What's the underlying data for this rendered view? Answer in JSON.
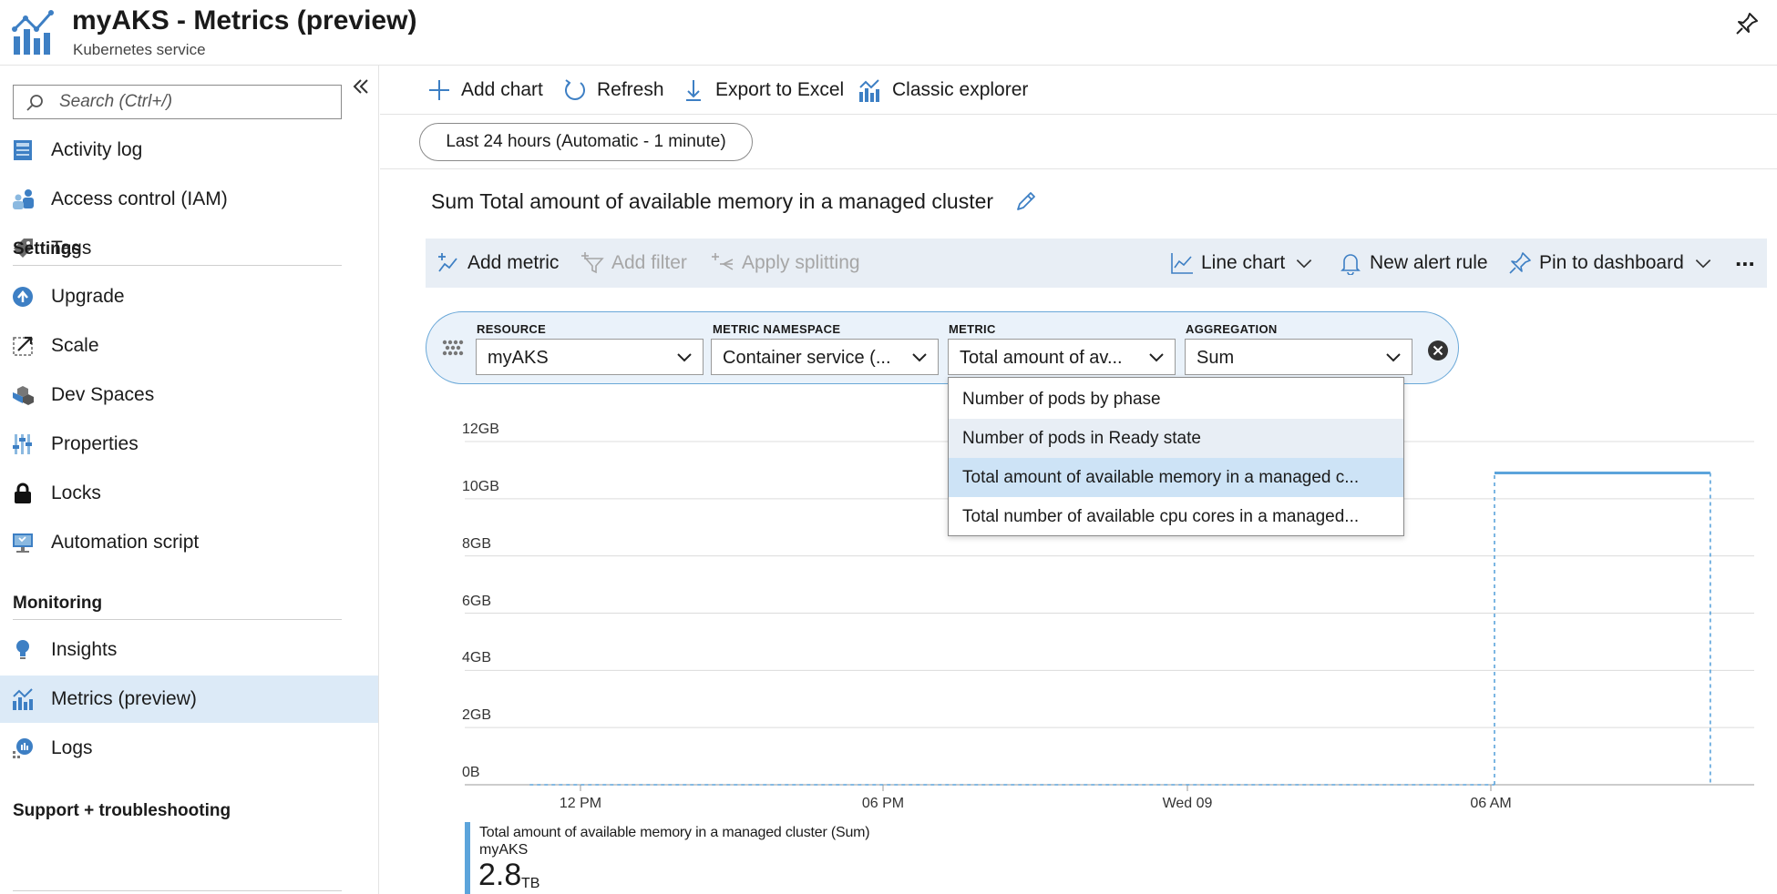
{
  "header": {
    "title": "myAKS - Metrics (preview)",
    "subtitle": "Kubernetes service"
  },
  "sidebar": {
    "search_placeholder": "Search (Ctrl+/)",
    "items_top": [
      {
        "label": "Activity log",
        "icon": "activity-log-icon"
      },
      {
        "label": "Access control (IAM)",
        "icon": "iam-people-icon"
      },
      {
        "label": "Tags",
        "icon": "tag-icon"
      }
    ],
    "settings_heading": "Settings",
    "settings_items": [
      {
        "label": "Upgrade",
        "icon": "upgrade-arrow-icon"
      },
      {
        "label": "Scale",
        "icon": "scale-icon"
      },
      {
        "label": "Dev Spaces",
        "icon": "dev-spaces-icon"
      },
      {
        "label": "Properties",
        "icon": "properties-sliders-icon"
      },
      {
        "label": "Locks",
        "icon": "lock-icon"
      },
      {
        "label": "Automation script",
        "icon": "automation-monitor-icon"
      }
    ],
    "monitoring_heading": "Monitoring",
    "monitoring_items": [
      {
        "label": "Insights",
        "icon": "lightbulb-icon"
      },
      {
        "label": "Metrics (preview)",
        "icon": "metrics-chart-icon",
        "active": true
      },
      {
        "label": "Logs",
        "icon": "logs-icon"
      }
    ],
    "support_heading": "Support + troubleshooting"
  },
  "toolbar": {
    "add_chart": "Add chart",
    "refresh": "Refresh",
    "export": "Export to Excel",
    "classic": "Classic explorer"
  },
  "time_range": "Last 24 hours (Automatic - 1 minute)",
  "chart_title": "Sum Total amount of available memory in a managed cluster",
  "chart_commands": {
    "add_metric": "Add metric",
    "add_filter": "Add filter",
    "apply_splitting": "Apply splitting",
    "line_chart": "Line chart",
    "new_alert": "New alert rule",
    "pin": "Pin to dashboard",
    "more": "..."
  },
  "selector": {
    "resource_label": "RESOURCE",
    "resource_value": "myAKS",
    "namespace_label": "METRIC NAMESPACE",
    "namespace_value": "Container service (...",
    "metric_label": "METRIC",
    "metric_value": "Total amount of av...",
    "aggregation_label": "AGGREGATION",
    "aggregation_value": "Sum"
  },
  "dropdown": {
    "options": [
      "Number of pods by phase",
      "Number of pods in Ready state",
      "Total amount of available memory in a managed c...",
      "Total number of available cpu cores in a managed..."
    ],
    "hover_index": 1,
    "selected_index": 2
  },
  "colors": {
    "accent": "#0078d4",
    "series": "#5ca4db",
    "active_nav": "#dceaf7"
  },
  "legend": {
    "metric": "Total amount of available memory in a managed cluster (Sum)",
    "resource": "myAKS",
    "value": "2.8",
    "unit": "TB"
  },
  "chart_data": {
    "type": "line",
    "y_tick_labels": [
      "12GB",
      "10GB",
      "8GB",
      "6GB",
      "4GB",
      "2GB",
      "0B"
    ],
    "x_tick_labels": [
      "12 PM",
      "06 PM",
      "Wed 09",
      "06 AM"
    ],
    "ylim_gb": [
      0,
      12
    ],
    "series": [
      {
        "name": "Total amount of available memory in a managed cluster (Sum)",
        "points": [
          {
            "t": "11 AM",
            "gb": 0
          },
          {
            "t": "06 AM",
            "gb": 0
          },
          {
            "t": "06 AM",
            "gb": 10.9
          },
          {
            "t": "10:15 AM",
            "gb": 10.9
          },
          {
            "t": "10:15 AM",
            "gb": 0
          }
        ]
      }
    ],
    "grid": true
  }
}
